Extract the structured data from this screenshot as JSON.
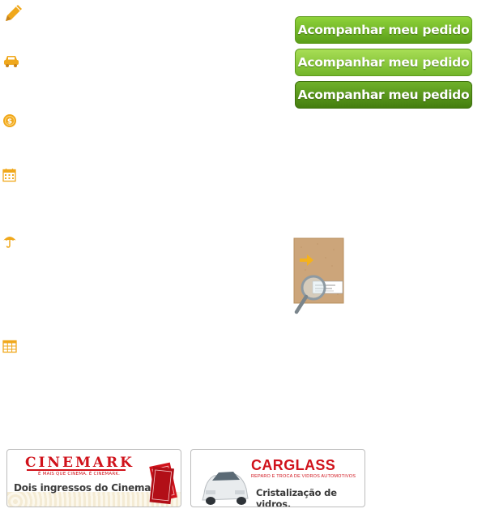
{
  "left_icons": [
    {
      "name": "pencil-icon",
      "color": "#f0a81c"
    },
    {
      "name": "car-icon",
      "color": "#f0a81c"
    },
    {
      "name": "coin-icon",
      "color": "#f0a81c"
    },
    {
      "name": "calendar-icon",
      "color": "#f0a81c"
    },
    {
      "name": "umbrella-icon",
      "color": "#f0a81c"
    },
    {
      "name": "table-icon",
      "color": "#f0a81c"
    }
  ],
  "buttons": {
    "track_order_1": "Acompanhar meu pedido",
    "track_order_2": "Acompanhar meu pedido",
    "track_order_3": "Acompanhar meu pedido"
  },
  "banners": {
    "cinemark": {
      "logo": "CINEMARK",
      "tagline": "É MAIS QUE CINEMA. É CINEMARK.",
      "text": "Dois ingressos do Cinemark."
    },
    "carglass": {
      "logo": "CARGLASS",
      "tagline": "REPARO E TROCA DE VIDROS AUTOMOTIVOS",
      "text": "Cristalização de vidros."
    }
  },
  "colors": {
    "icon_orange": "#f0a81c",
    "button_green": "#6fb12a",
    "brand_red": "#d0121b"
  }
}
